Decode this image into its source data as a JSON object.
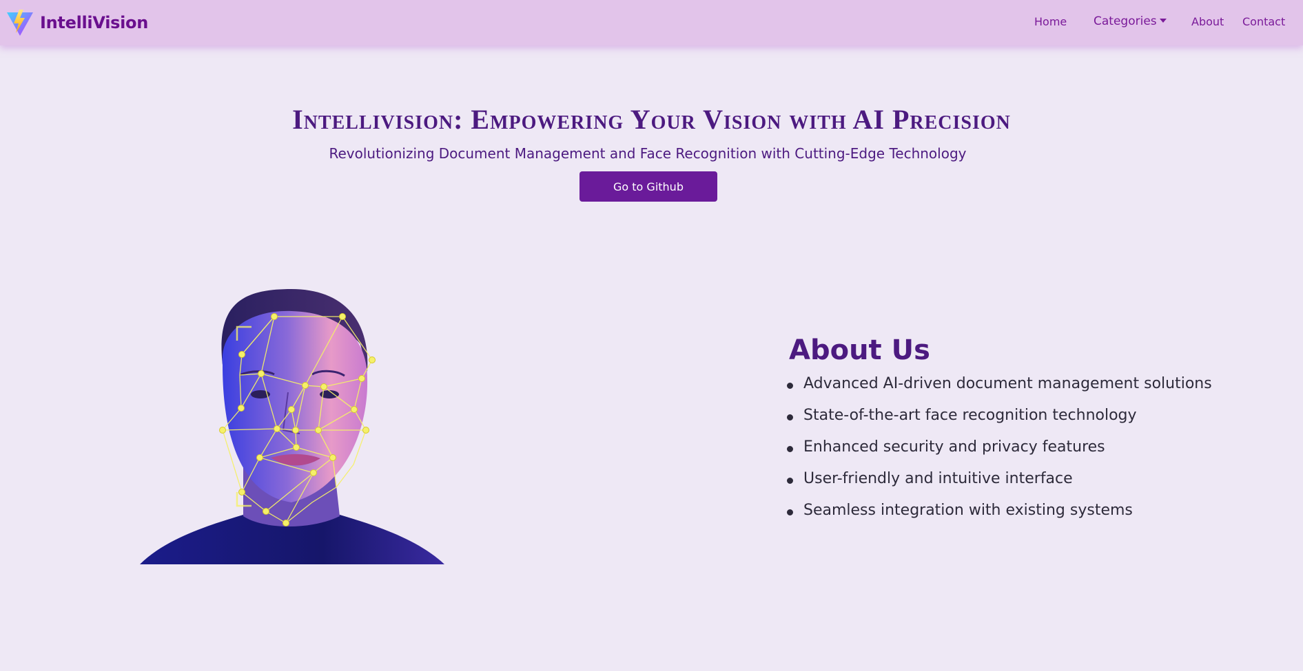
{
  "brand": {
    "name": "IntelliVision",
    "logo_icon": "lightning-triangle-logo-icon"
  },
  "nav": {
    "home": "Home",
    "categories": "Categories",
    "about": "About",
    "contact": "Contact"
  },
  "hero": {
    "title": "Intellivision: Empowering Your Vision with AI Precision",
    "subtitle": "Revolutionizing Document Management and Face Recognition with Cutting-Edge Technology",
    "button_label": "Go to Github"
  },
  "about": {
    "title": "About Us",
    "items": [
      "Advanced AI-driven document management solutions",
      "State-of-the-art face recognition technology",
      "Enhanced security and privacy features",
      "User-friendly and intuitive interface",
      "Seamless integration with existing systems"
    ]
  },
  "colors": {
    "navbar": "#e2c4ea",
    "page_background": "#eee8f5",
    "accent": "#6a1b9a",
    "heading": "#4c1a80"
  }
}
